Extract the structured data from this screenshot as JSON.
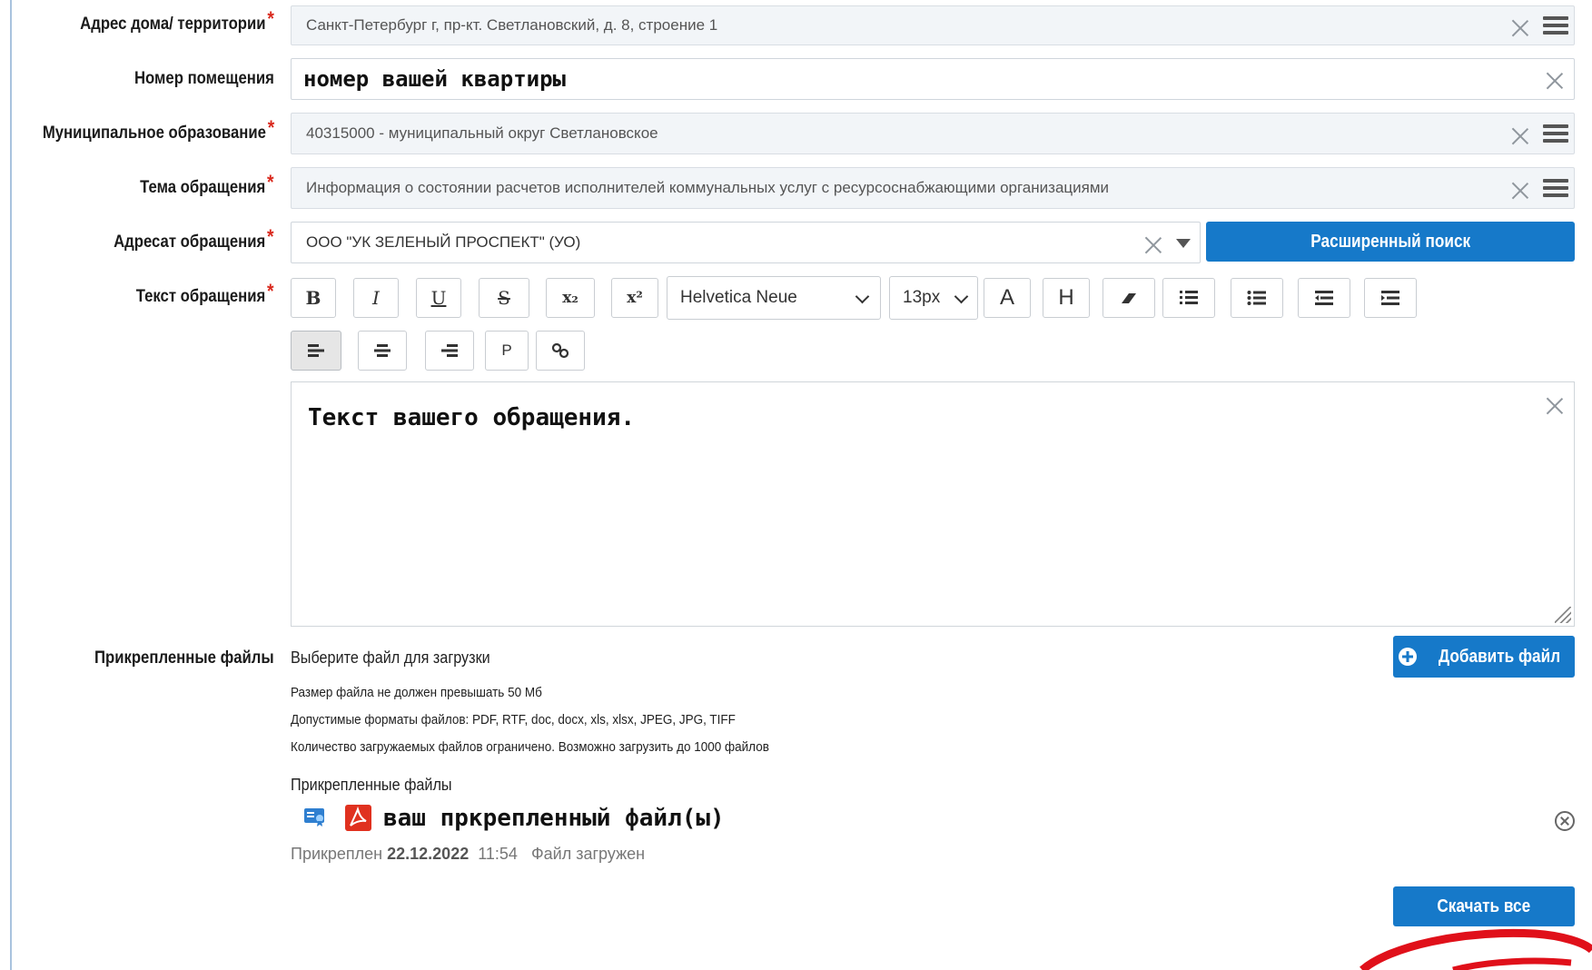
{
  "form": {
    "address_label": "Адрес дома/ территории",
    "address_value": "Санкт-Петербург г, пр-кт. Светлановский, д. 8, строение 1",
    "room_label": "Номер помещения",
    "room_value": "номер вашей квартиры",
    "municipality_label": "Муниципальное образование",
    "municipality_value": "40315000 - муниципальный округ Светлановское",
    "topic_label": "Тема обращения",
    "topic_value": "Информация о состоянии расчетов исполнителей коммунальных услуг с ресурсоснабжающими организациями",
    "addressee_label": "Адресат обращения",
    "addressee_value": "ООО \"УК ЗЕЛЕНЫЙ ПРОСПЕКТ\" (УО)",
    "advanced_search_label": "Расширенный поиск",
    "text_label": "Текст обращения",
    "text_value": "Текст вашего обращения.",
    "required_mark": "*"
  },
  "toolbar": {
    "bold": "B",
    "italic": "I",
    "underline": "U",
    "strike": "S",
    "subscript": "x₂",
    "superscript": "x²",
    "font_family": "Helvetica Neue",
    "font_size": "13px",
    "font_color": "A",
    "highlight": "H",
    "paragraph": "P"
  },
  "files": {
    "label": "Прикрепленные файлы",
    "choose_text": "Выберите файл для загрузки",
    "add_button": "Добавить файл",
    "limit_size": "Размер файла не должен превышать 50 Мб",
    "formats": "Допустимые форматы файлов: PDF, RTF, doc, docx, xls, xlsx, JPEG, JPG, TIFF",
    "count_limit": "Количество загружаемых файлов ограничено. Возможно загрузить до 1000 файлов",
    "attached_heading": "Прикрепленные файлы",
    "file_name": "ваш пркрепленный файл(ы)",
    "attached_prefix": "Прикреплен",
    "attached_date": "22.12.2022",
    "attached_time": "11:54",
    "attached_status": "Файл загружен",
    "download_all": "Скачать все"
  },
  "colors": {
    "accent": "#1679c9",
    "required": "#d9281c",
    "annotation": "#e0101a"
  }
}
